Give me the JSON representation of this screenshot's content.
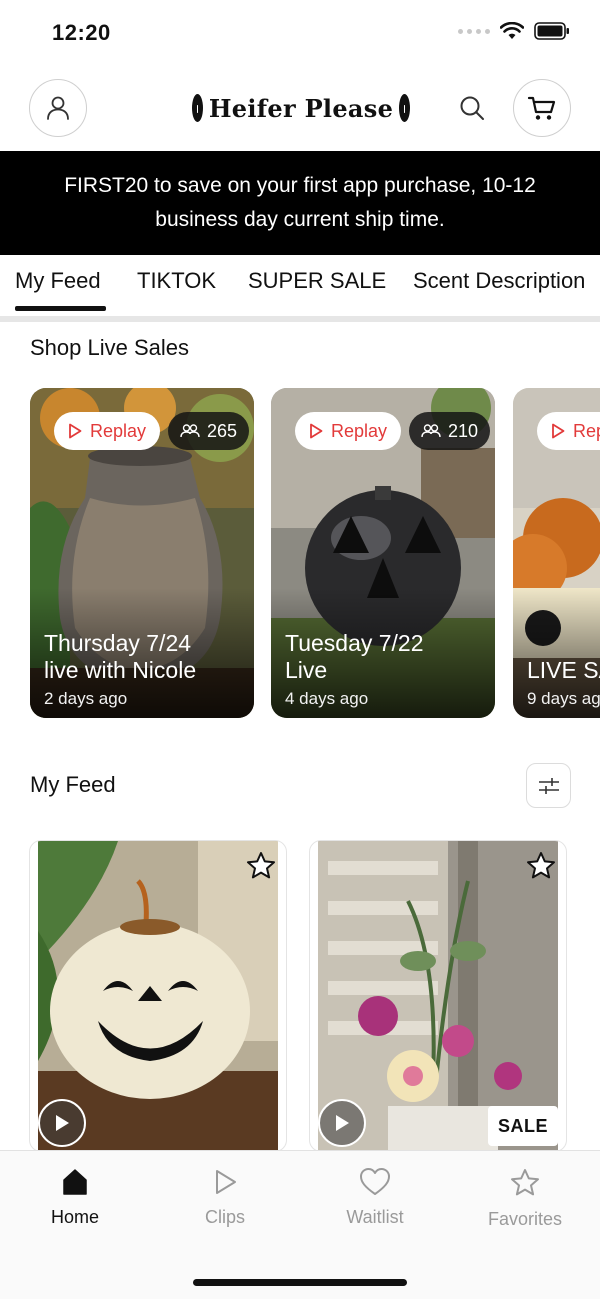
{
  "status_bar": {
    "time": "12:20"
  },
  "header": {
    "logo_text": "Heifer Please",
    "profile_icon": "user-icon",
    "search_icon": "search-icon",
    "cart_icon": "cart-icon"
  },
  "promo_banner": {
    "text": "FIRST20 to save on your first app purchase, 10-12 business day current ship time."
  },
  "tabs": [
    {
      "label": "My Feed",
      "active": true
    },
    {
      "label": "TIKTOK",
      "active": false
    },
    {
      "label": "SUPER SALE",
      "active": false
    },
    {
      "label": "Scent Description",
      "active": false
    }
  ],
  "live_sales": {
    "title": "Shop Live Sales",
    "cards": [
      {
        "replay_label": "Replay",
        "viewers": "265",
        "title_line1": "Thursday 7/24",
        "title_line2": "live with Nicole",
        "ago": "2 days ago"
      },
      {
        "replay_label": "Replay",
        "viewers": "210",
        "title_line1": "Tuesday 7/22",
        "title_line2": "Live",
        "ago": "4 days ago"
      },
      {
        "replay_label": "Replay",
        "viewers": "",
        "title_line1": "LIVE SALE",
        "title_line2": "",
        "ago": "9 days ago"
      }
    ]
  },
  "my_feed": {
    "title": "My Feed",
    "filter_icon": "sliders-icon",
    "products": [
      {
        "favorite_icon": "star-outline-icon",
        "video": true,
        "sale_badge": ""
      },
      {
        "favorite_icon": "star-outline-icon",
        "video": true,
        "sale_badge": "SALE"
      }
    ]
  },
  "bottom_nav": {
    "items": [
      {
        "label": "Home",
        "icon": "home-icon",
        "active": true
      },
      {
        "label": "Clips",
        "icon": "play-outline-icon",
        "active": false
      },
      {
        "label": "Waitlist",
        "icon": "heart-icon",
        "active": false
      },
      {
        "label": "Favorites",
        "icon": "star-icon",
        "active": false
      }
    ]
  },
  "colors": {
    "accent_replay": "#e23a3a",
    "banner_bg": "#000000",
    "text_primary": "#111111",
    "nav_inactive": "#9a9a9a"
  }
}
